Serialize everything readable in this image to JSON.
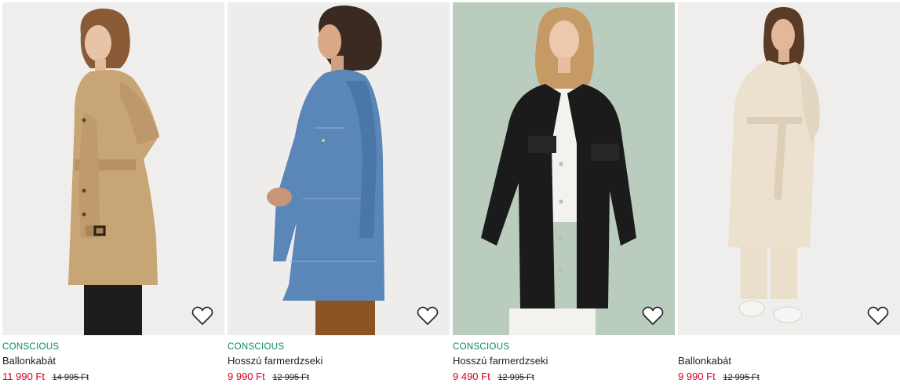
{
  "colors": {
    "conscious_green": "#0b8a5b",
    "sale_red": "#d6001c",
    "text": "#222222"
  },
  "products": [
    {
      "tag": "CONSCIOUS",
      "name": "Ballonkabát",
      "price": "11 990 Ft",
      "old_price": "14 995 Ft",
      "image_icon": "photo-beige-trench-coat",
      "favorite_icon": "heart-outline-icon"
    },
    {
      "tag": "CONSCIOUS",
      "name": "Hosszú farmerdzseki",
      "price": "9 990 Ft",
      "old_price": "12 995 Ft",
      "image_icon": "photo-blue-denim-jacket",
      "favorite_icon": "heart-outline-icon"
    },
    {
      "tag": "CONSCIOUS",
      "name": "Hosszú farmerdzseki",
      "price": "9 490 Ft",
      "old_price": "12 995 Ft",
      "image_icon": "photo-black-denim-jacket",
      "favorite_icon": "heart-outline-icon"
    },
    {
      "tag": "",
      "name": "Ballonkabát",
      "price": "9 990 Ft",
      "old_price": "12 995 Ft",
      "image_icon": "photo-cream-trench-coat",
      "favorite_icon": "heart-outline-icon"
    }
  ]
}
